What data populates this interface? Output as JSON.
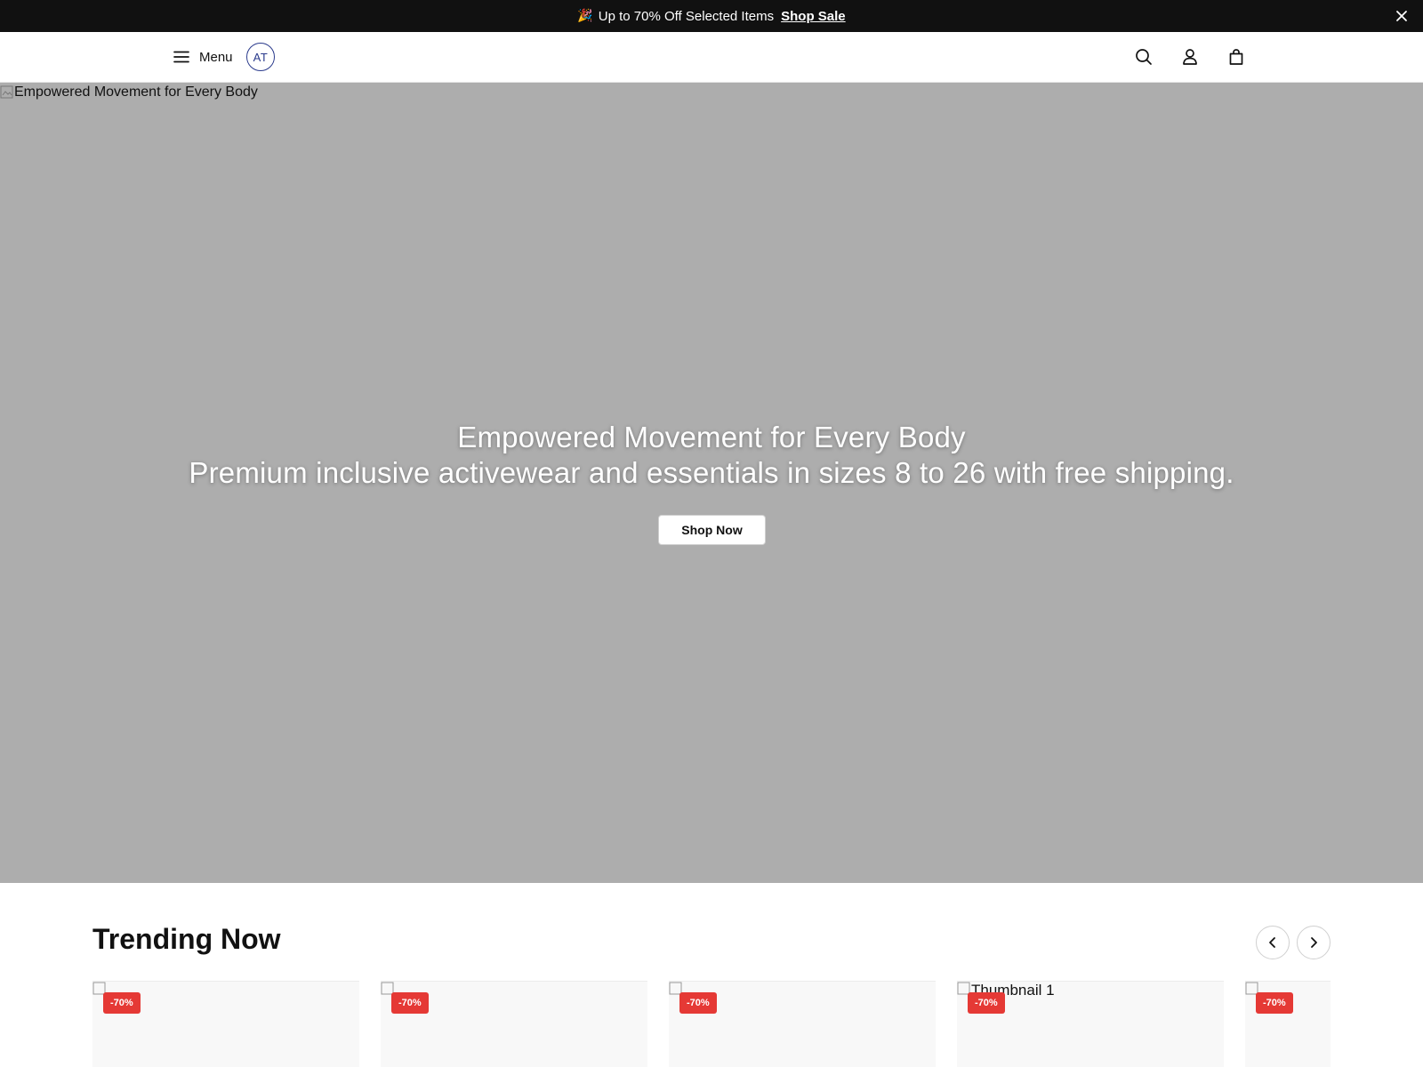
{
  "announcement": {
    "emoji": "🎉",
    "text": "Up to 70% Off Selected Items",
    "link_label": "Shop Sale",
    "close_icon": "close-icon"
  },
  "nav": {
    "menu_label": "Menu",
    "logo_text": "AT",
    "icons": [
      "menu-icon",
      "search-icon",
      "account-icon",
      "bag-icon"
    ]
  },
  "hero": {
    "image_alt": "Empowered Movement for Every Body",
    "title": "Empowered Movement for Every Body",
    "subtitle": "Premium inclusive activewear and essentials in sizes 8 to 26 with free shipping.",
    "cta_label": "Shop Now",
    "background_color": "#adadad"
  },
  "trending": {
    "title": "Trending Now",
    "prev_icon": "chevron-left-icon",
    "next_icon": "chevron-right-icon",
    "products": [
      {
        "alt": "",
        "badge": "-70%"
      },
      {
        "alt": "",
        "badge": "-70%"
      },
      {
        "alt": "",
        "badge": "-70%"
      },
      {
        "alt": "Thumbnail 1",
        "badge": "-70%"
      },
      {
        "alt": "",
        "badge": "-70%"
      }
    ]
  },
  "colors": {
    "announcement_bg": "#111111",
    "badge": "#e53935",
    "logo": "#2a3a8c"
  }
}
